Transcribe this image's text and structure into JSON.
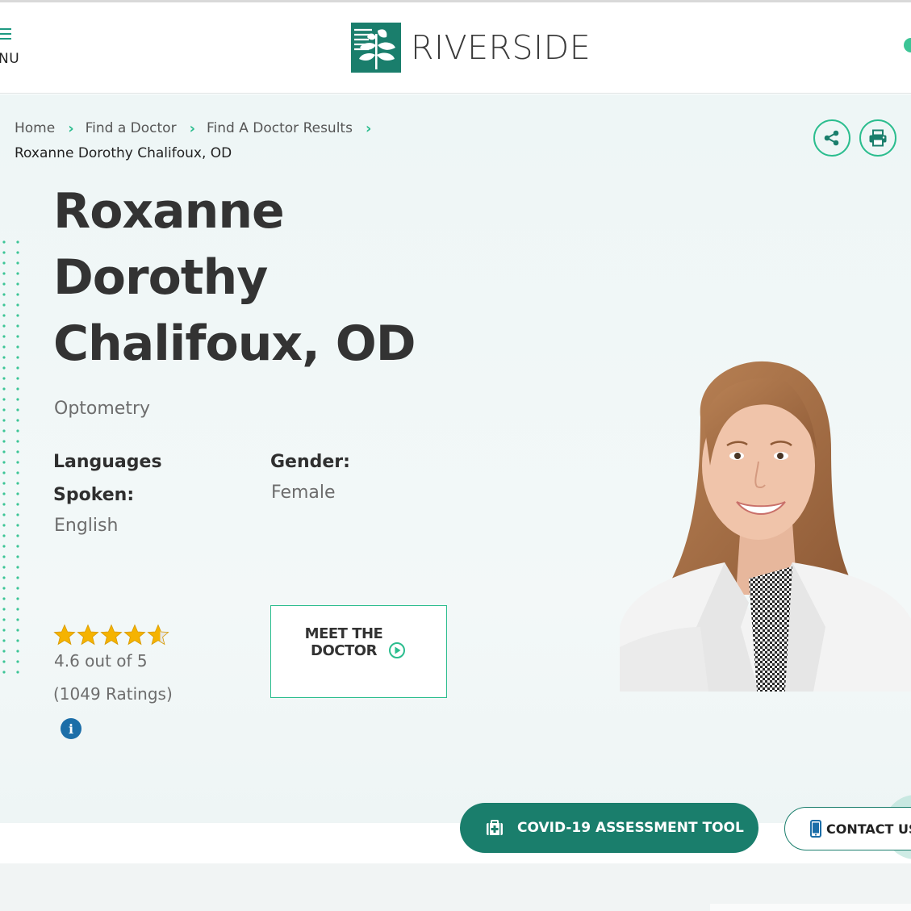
{
  "header": {
    "menu_label": "NU",
    "brand_name": "RIVERSIDE"
  },
  "breadcrumb": {
    "items": [
      "Home",
      "Find a Doctor",
      "Find A Doctor Results"
    ],
    "current": "Roxanne Dorothy Chalifoux, OD"
  },
  "doctor": {
    "name_line1": "Roxanne",
    "name_line2": "Dorothy",
    "name_line3": "Chalifoux, OD",
    "specialty": "Optometry",
    "languages_label": "Languages Spoken:",
    "languages_value": "English",
    "gender_label": "Gender:",
    "gender_value": "Female"
  },
  "rating": {
    "stars": 4.6,
    "max_stars": 5,
    "text": "4.6 out of 5",
    "count_text": "(1049 Ratings)"
  },
  "meet_button": {
    "label": "Meet the Doctor"
  },
  "actions": {
    "covid_label": "COVID-19 ASSESSMENT TOOL",
    "contact_label": "CONTACT US"
  },
  "colors": {
    "brand_green": "#1a7e6c",
    "accent_green": "#2bbd8e",
    "star_gold": "#f5b301",
    "info_blue": "#1c6ea8"
  },
  "icons": [
    "hamburger-icon",
    "riverside-logo",
    "share-icon",
    "print-icon",
    "star-icon",
    "info-icon",
    "play-circle-icon",
    "medical-kit-icon",
    "phone-icon"
  ]
}
